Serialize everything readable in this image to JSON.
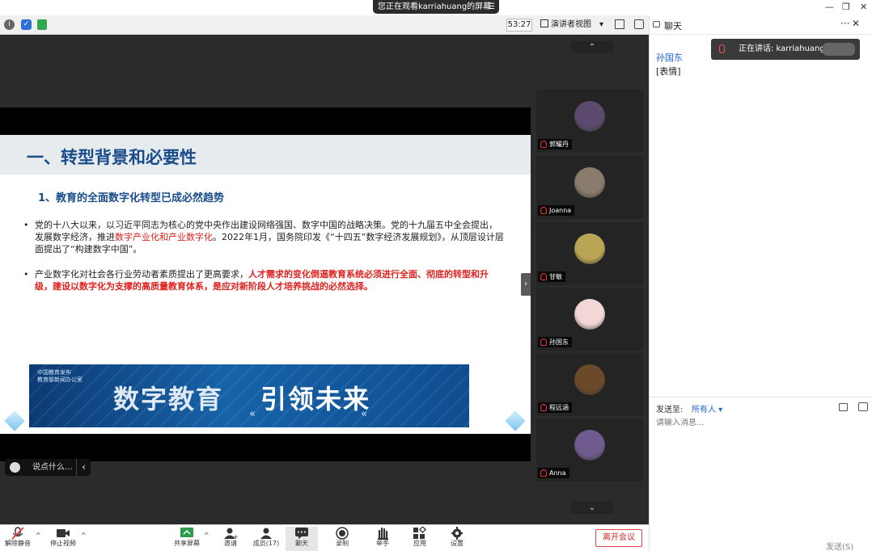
{
  "window": {
    "share_banner": "您正在观看karriahuang的屏幕",
    "menu_glyph": "☰",
    "minimize": "—",
    "restore": "❐",
    "close": "✕"
  },
  "meeting_bar": {
    "timer": "53:27",
    "view_mode": "演讲者视图",
    "view_caret": "▾"
  },
  "slide": {
    "title": "一、转型背景和必要性",
    "subtitle": "1、教育的全面数字化转型已成必然趋势",
    "bullet1": {
      "part1": "党的十八大以来，以习近平同志为核心的党中央作出建设网络强国、数字中国的战略决策。党的十九届五中全会提出，发展数字经济，推进",
      "highlight": "数字产业化和产业数字化",
      "part2": "。2022年1月，国务院印发《“十四五”数字经济发展规划》，从顶层设计层面提出了“构建数字中国”。"
    },
    "bullet2": {
      "part1": "产业数字化对社会各行业劳动者素质提出了更高要求，",
      "highlight": "人才需求的变化倒逼教育系统必须进行全面、彻底的转型和升级，建设以数字化为支撑的高质量教育体系，是应对新阶段人才培养挑战的必然选择。"
    },
    "bullet_glyph": "•",
    "banner_logo_line1": "中国教育发布",
    "banner_logo_line2": "教育部新闻办公室",
    "banner_text1": "数字教育",
    "banner_text2": "引领未来",
    "banner_chevron": "«"
  },
  "say_box": {
    "placeholder": "说点什么...",
    "collapse": "‹"
  },
  "gallery": {
    "up": "⌃",
    "down": "⌄",
    "handle": "›",
    "participants": [
      {
        "name": "郭耀丹",
        "color": "#5b4a6e"
      },
      {
        "name": "Joanna",
        "color": "#8a7c6c"
      },
      {
        "name": "甘敏",
        "color": "#b9a553"
      },
      {
        "name": "孙国东",
        "color": "#f3d7d6"
      },
      {
        "name": "程远涵",
        "color": "#6b4a2a"
      },
      {
        "name": "Anna",
        "color": "#6f5b8e"
      }
    ]
  },
  "chat": {
    "title": "聊天",
    "more": "···",
    "close": "✕",
    "speaking": "正在讲话: karriahuang;",
    "messages": [
      {
        "sender": "孙国东",
        "text": "[表情]"
      }
    ],
    "send_to_label": "发送至:",
    "send_to_value": "所有人 ▾",
    "input_placeholder": "请输入消息...",
    "send_button": "发送(S)"
  },
  "toolbar": {
    "unmute": "解除静音",
    "stop_video": "停止视频",
    "share_screen": "共享屏幕",
    "invite": "邀请",
    "members": "成员(17)",
    "chat": "聊天",
    "record": "录制",
    "raise_hand": "举手",
    "apps": "应用",
    "settings": "设置",
    "leave": "离开会议",
    "caret": "^"
  }
}
